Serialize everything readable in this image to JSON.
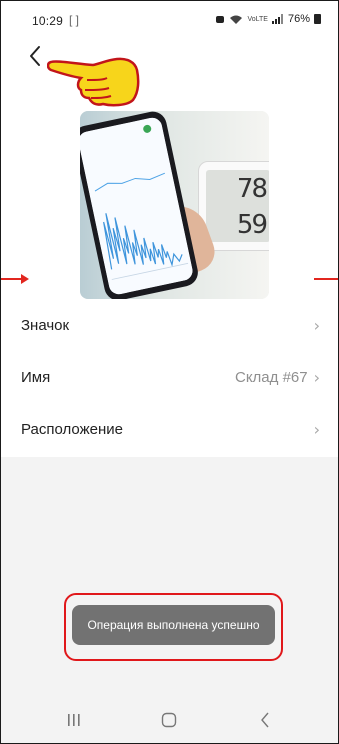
{
  "status_bar": {
    "time": "10:29",
    "extra_icons": "[ ]",
    "network": "VoLTE",
    "battery": "76%"
  },
  "header": {
    "back_icon": "chevron-left-icon",
    "pointer_icon": "pointing-hand-icon"
  },
  "device_image": {
    "thermo_temp": "78",
    "thermo_humidity": "59"
  },
  "settings": [
    {
      "label": "Значок",
      "value": ""
    },
    {
      "label": "Имя",
      "value": "Склад #67"
    },
    {
      "label": "Расположение",
      "value": ""
    }
  ],
  "toast": {
    "message": "Операция выполнена успешно"
  },
  "nav_bar": {
    "recent_icon": "recent-apps-icon",
    "home_icon": "home-icon",
    "back_icon": "back-nav-icon"
  },
  "colors": {
    "highlight": "#e0171a",
    "toast_bg": "#727272",
    "pointer": "#f6d21a"
  }
}
